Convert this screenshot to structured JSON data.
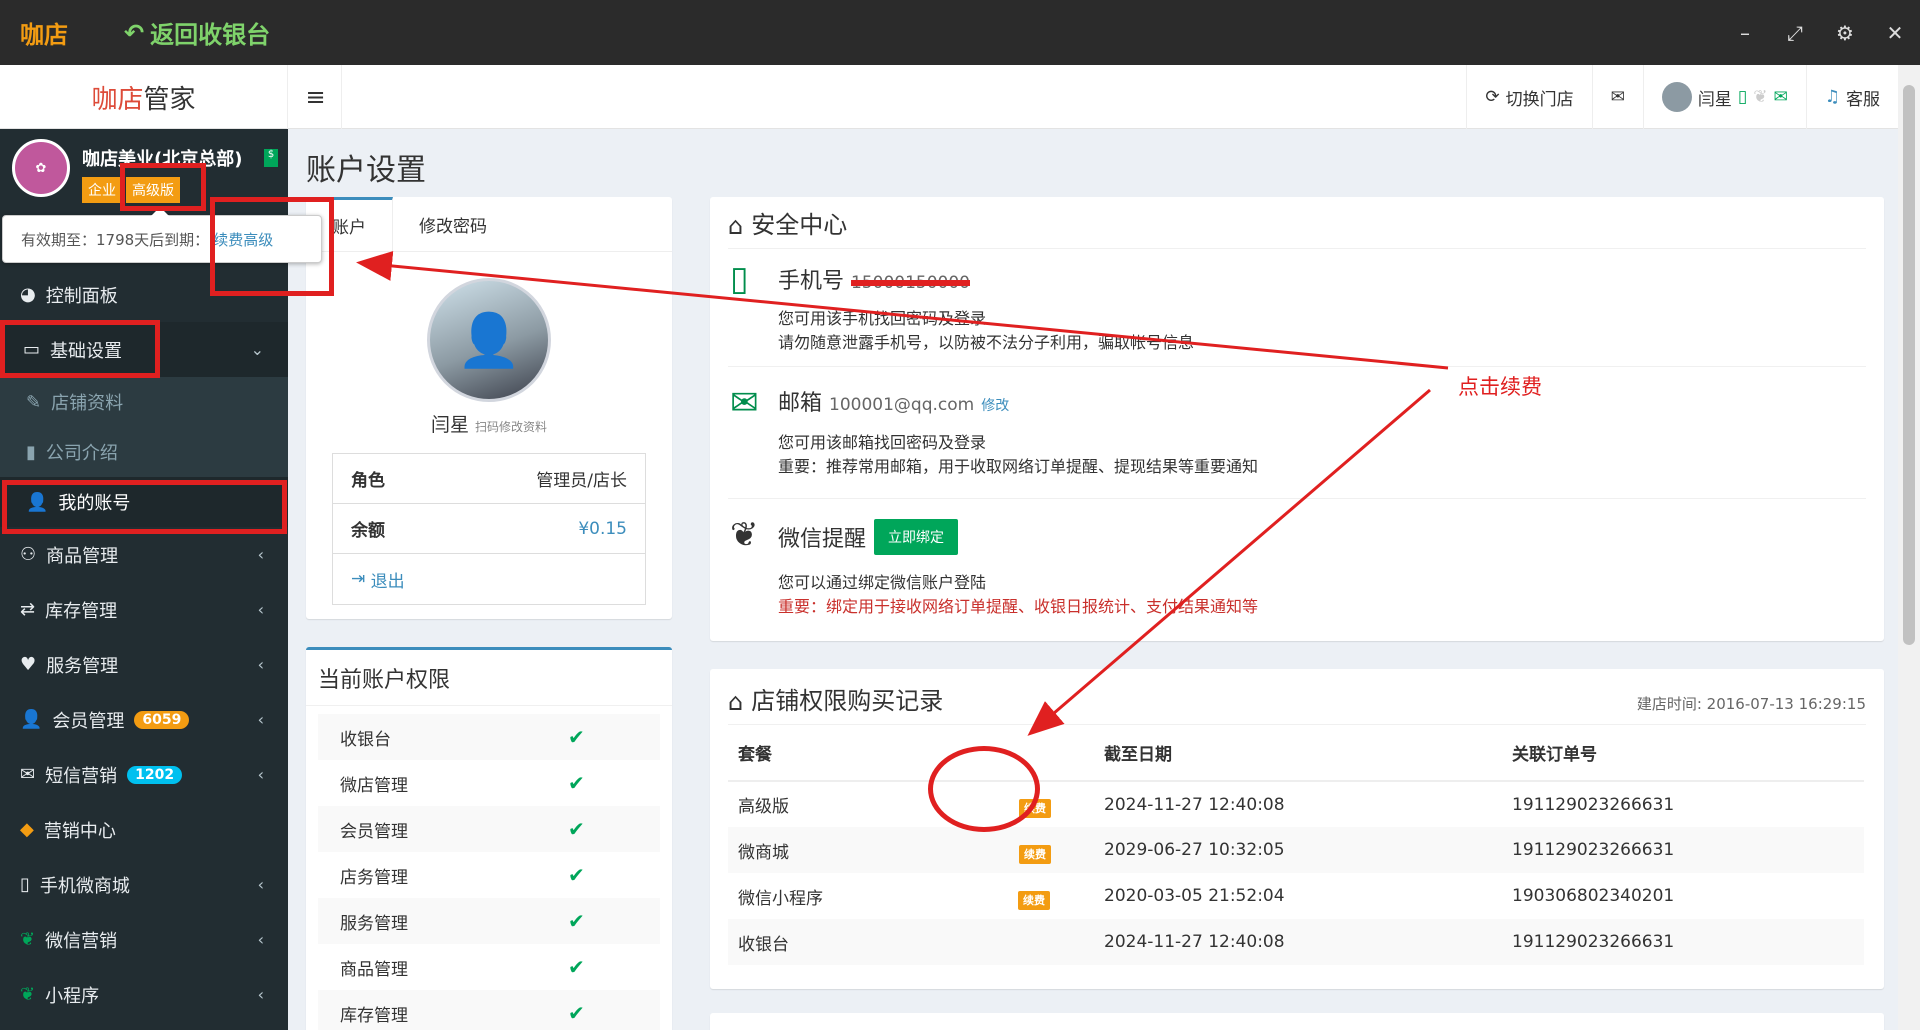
{
  "topbar": {
    "app": "咖店",
    "back": "返回收银台",
    "win": [
      "–",
      "⤢",
      "⚙",
      "✕"
    ]
  },
  "header": {
    "logo_a": "咖店",
    "logo_b": "管家",
    "switch": "切换门店",
    "user": "闫星",
    "service": "客服"
  },
  "sidebar": {
    "store": "咖店美业(北京总部)",
    "tag1": "企业",
    "tag2": "高级版",
    "expiry": "有效期至：1798天后到期：",
    "renew": "续费高级",
    "items": [
      {
        "label": "控制面板",
        "icon": "◕"
      },
      {
        "label": "基础设置",
        "icon": "▭",
        "chev": "⌄"
      },
      {
        "label": "店铺资料",
        "icon": "✎"
      },
      {
        "label": "公司介绍",
        "icon": "▮"
      },
      {
        "label": "我的账号",
        "icon": "👤"
      },
      {
        "label": "商品管理",
        "icon": "⚇",
        "chev": "‹"
      },
      {
        "label": "库存管理",
        "icon": "⇄",
        "chev": "‹"
      },
      {
        "label": "服务管理",
        "icon": "♥",
        "chev": "‹"
      },
      {
        "label": "会员管理",
        "icon": "👤",
        "chev": "‹",
        "badge": "6059"
      },
      {
        "label": "短信营销",
        "icon": "✉",
        "chev": "‹",
        "badge": "1202"
      },
      {
        "label": "营销中心",
        "icon": "◆"
      },
      {
        "label": "手机微商城",
        "icon": "▯",
        "chev": "‹"
      },
      {
        "label": "微信营销",
        "icon": "❦",
        "chev": "‹"
      },
      {
        "label": "小程序",
        "icon": "❦",
        "chev": "‹"
      }
    ]
  },
  "colors": {
    "orange": "#f39c12",
    "green": "#00a65a",
    "blue": "#3c8dbc",
    "red": "#e02020",
    "sidebar": "#222d32"
  },
  "page": {
    "title": "账户设置"
  },
  "profile": {
    "tab1": "账户",
    "tab2": "修改密码",
    "name": "闫星",
    "hint": "扫码修改资料",
    "role_label": "角色",
    "role": "管理员/店长",
    "balance_label": "余额",
    "balance": "¥0.15",
    "logout": "退出"
  },
  "perms": {
    "title": "当前账户权限",
    "items": [
      "收银台",
      "微店管理",
      "会员管理",
      "店务管理",
      "服务管理",
      "商品管理",
      "库存管理"
    ],
    "check": "✔"
  },
  "security": {
    "title": "安全中心",
    "phone": {
      "title": "手机号",
      "value": "15000150000",
      "l1": "您可用该手机找回密码及登录",
      "l2": "请勿随意泄露手机号，以防被不法分子利用，骗取帐号信息"
    },
    "email": {
      "title": "邮箱",
      "value": "100001@qq.com",
      "edit": "修改",
      "l1": "您可用该邮箱找回密码及登录",
      "l2": "重要：推荐常用邮箱，用于收取网络订单提醒、提现结果等重要通知"
    },
    "wechat": {
      "title": "微信提醒",
      "btn": "立即绑定",
      "l1": "您可以通过绑定微信账户登陆",
      "l2": "重要：绑定用于接收网络订单提醒、收银日报统计、支付结果通知等"
    }
  },
  "records": {
    "title": "店铺权限购买记录",
    "created": "建店时间: 2016-07-13 16:29:15",
    "headers": [
      "套餐",
      "",
      "截至日期",
      "关联订单号"
    ],
    "renew": "续费",
    "rows": [
      {
        "plan": "高级版",
        "date": "2024-11-27 12:40:08",
        "order": "191129023266631"
      },
      {
        "plan": "微商城",
        "date": "2029-06-27 10:32:05",
        "order": "191129023266631"
      },
      {
        "plan": "微信小程序",
        "date": "2020-03-05 21:52:04",
        "order": "190306802340201"
      },
      {
        "plan": "收银台",
        "date": "2024-11-27 12:40:08",
        "order": "191129023266631"
      }
    ]
  },
  "annotation": {
    "text": "点击续费"
  }
}
